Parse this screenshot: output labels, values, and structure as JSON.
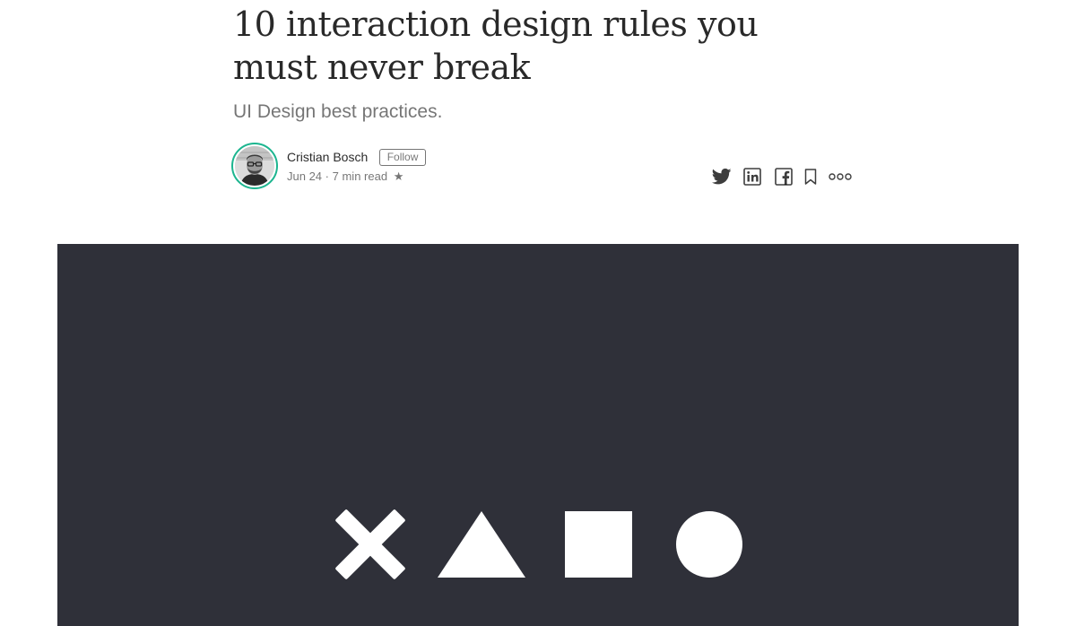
{
  "article": {
    "title": "10 interaction design rules you must never break",
    "subtitle": "UI Design best practices.",
    "author": {
      "name": "Cristian Bosch",
      "follow_label": "Follow",
      "ring_color": "#1cb58f"
    },
    "meta": {
      "date": "Jun 24",
      "separator": "·",
      "read_time": "7 min read",
      "star": "★"
    }
  },
  "share_actions": [
    {
      "name": "twitter-icon",
      "label": "Twitter"
    },
    {
      "name": "linkedin-icon",
      "label": "LinkedIn"
    },
    {
      "name": "facebook-icon",
      "label": "Facebook"
    },
    {
      "name": "bookmark-icon",
      "label": "Bookmark"
    },
    {
      "name": "more-icon",
      "label": "More"
    }
  ],
  "hero_image": {
    "background": "#2f3039",
    "shapes": [
      "cross",
      "triangle",
      "square",
      "circle"
    ],
    "shape_color": "#ffffff"
  }
}
